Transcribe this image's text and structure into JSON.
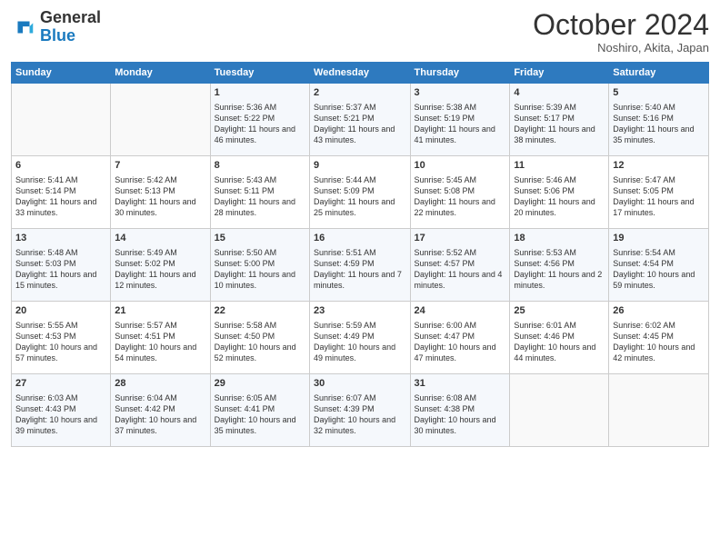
{
  "header": {
    "logo_general": "General",
    "logo_blue": "Blue",
    "month_title": "October 2024",
    "subtitle": "Noshiro, Akita, Japan"
  },
  "days_of_week": [
    "Sunday",
    "Monday",
    "Tuesday",
    "Wednesday",
    "Thursday",
    "Friday",
    "Saturday"
  ],
  "weeks": [
    [
      {
        "day": "",
        "info": ""
      },
      {
        "day": "",
        "info": ""
      },
      {
        "day": "1",
        "info": "Sunrise: 5:36 AM\nSunset: 5:22 PM\nDaylight: 11 hours and 46 minutes."
      },
      {
        "day": "2",
        "info": "Sunrise: 5:37 AM\nSunset: 5:21 PM\nDaylight: 11 hours and 43 minutes."
      },
      {
        "day": "3",
        "info": "Sunrise: 5:38 AM\nSunset: 5:19 PM\nDaylight: 11 hours and 41 minutes."
      },
      {
        "day": "4",
        "info": "Sunrise: 5:39 AM\nSunset: 5:17 PM\nDaylight: 11 hours and 38 minutes."
      },
      {
        "day": "5",
        "info": "Sunrise: 5:40 AM\nSunset: 5:16 PM\nDaylight: 11 hours and 35 minutes."
      }
    ],
    [
      {
        "day": "6",
        "info": "Sunrise: 5:41 AM\nSunset: 5:14 PM\nDaylight: 11 hours and 33 minutes."
      },
      {
        "day": "7",
        "info": "Sunrise: 5:42 AM\nSunset: 5:13 PM\nDaylight: 11 hours and 30 minutes."
      },
      {
        "day": "8",
        "info": "Sunrise: 5:43 AM\nSunset: 5:11 PM\nDaylight: 11 hours and 28 minutes."
      },
      {
        "day": "9",
        "info": "Sunrise: 5:44 AM\nSunset: 5:09 PM\nDaylight: 11 hours and 25 minutes."
      },
      {
        "day": "10",
        "info": "Sunrise: 5:45 AM\nSunset: 5:08 PM\nDaylight: 11 hours and 22 minutes."
      },
      {
        "day": "11",
        "info": "Sunrise: 5:46 AM\nSunset: 5:06 PM\nDaylight: 11 hours and 20 minutes."
      },
      {
        "day": "12",
        "info": "Sunrise: 5:47 AM\nSunset: 5:05 PM\nDaylight: 11 hours and 17 minutes."
      }
    ],
    [
      {
        "day": "13",
        "info": "Sunrise: 5:48 AM\nSunset: 5:03 PM\nDaylight: 11 hours and 15 minutes."
      },
      {
        "day": "14",
        "info": "Sunrise: 5:49 AM\nSunset: 5:02 PM\nDaylight: 11 hours and 12 minutes."
      },
      {
        "day": "15",
        "info": "Sunrise: 5:50 AM\nSunset: 5:00 PM\nDaylight: 11 hours and 10 minutes."
      },
      {
        "day": "16",
        "info": "Sunrise: 5:51 AM\nSunset: 4:59 PM\nDaylight: 11 hours and 7 minutes."
      },
      {
        "day": "17",
        "info": "Sunrise: 5:52 AM\nSunset: 4:57 PM\nDaylight: 11 hours and 4 minutes."
      },
      {
        "day": "18",
        "info": "Sunrise: 5:53 AM\nSunset: 4:56 PM\nDaylight: 11 hours and 2 minutes."
      },
      {
        "day": "19",
        "info": "Sunrise: 5:54 AM\nSunset: 4:54 PM\nDaylight: 10 hours and 59 minutes."
      }
    ],
    [
      {
        "day": "20",
        "info": "Sunrise: 5:55 AM\nSunset: 4:53 PM\nDaylight: 10 hours and 57 minutes."
      },
      {
        "day": "21",
        "info": "Sunrise: 5:57 AM\nSunset: 4:51 PM\nDaylight: 10 hours and 54 minutes."
      },
      {
        "day": "22",
        "info": "Sunrise: 5:58 AM\nSunset: 4:50 PM\nDaylight: 10 hours and 52 minutes."
      },
      {
        "day": "23",
        "info": "Sunrise: 5:59 AM\nSunset: 4:49 PM\nDaylight: 10 hours and 49 minutes."
      },
      {
        "day": "24",
        "info": "Sunrise: 6:00 AM\nSunset: 4:47 PM\nDaylight: 10 hours and 47 minutes."
      },
      {
        "day": "25",
        "info": "Sunrise: 6:01 AM\nSunset: 4:46 PM\nDaylight: 10 hours and 44 minutes."
      },
      {
        "day": "26",
        "info": "Sunrise: 6:02 AM\nSunset: 4:45 PM\nDaylight: 10 hours and 42 minutes."
      }
    ],
    [
      {
        "day": "27",
        "info": "Sunrise: 6:03 AM\nSunset: 4:43 PM\nDaylight: 10 hours and 39 minutes."
      },
      {
        "day": "28",
        "info": "Sunrise: 6:04 AM\nSunset: 4:42 PM\nDaylight: 10 hours and 37 minutes."
      },
      {
        "day": "29",
        "info": "Sunrise: 6:05 AM\nSunset: 4:41 PM\nDaylight: 10 hours and 35 minutes."
      },
      {
        "day": "30",
        "info": "Sunrise: 6:07 AM\nSunset: 4:39 PM\nDaylight: 10 hours and 32 minutes."
      },
      {
        "day": "31",
        "info": "Sunrise: 6:08 AM\nSunset: 4:38 PM\nDaylight: 10 hours and 30 minutes."
      },
      {
        "day": "",
        "info": ""
      },
      {
        "day": "",
        "info": ""
      }
    ]
  ]
}
